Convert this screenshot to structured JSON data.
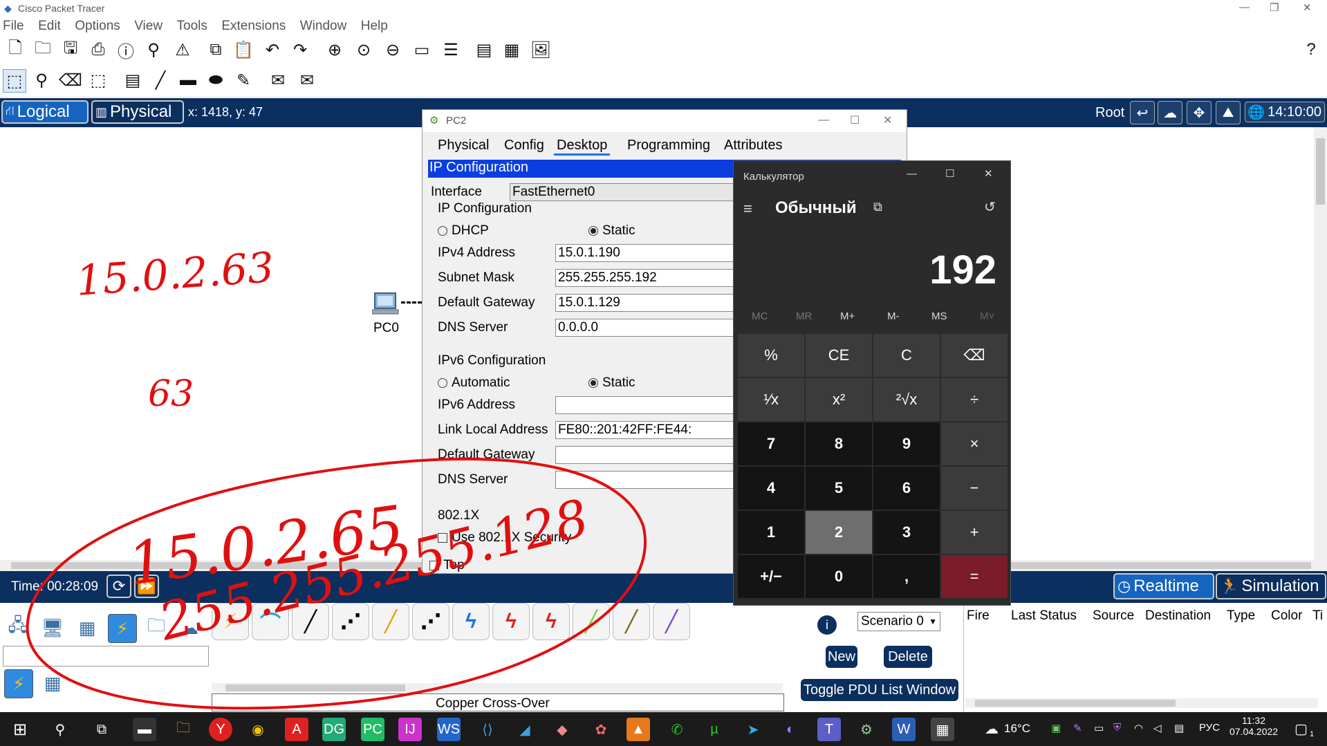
{
  "app": {
    "title": "Cisco Packet Tracer"
  },
  "menu": [
    "File",
    "Edit",
    "Options",
    "View",
    "Tools",
    "Extensions",
    "Window",
    "Help"
  ],
  "mode_bar": {
    "logical": "Logical",
    "physical": "Physical",
    "coords": "x: 1418, y: 47",
    "root": "Root",
    "clock": "14:10:00"
  },
  "workspace": {
    "device_label": "PC0"
  },
  "sim_bar": {
    "time": "Time: 00:28:09",
    "realtime": "Realtime",
    "simulation": "Simulation"
  },
  "bottom": {
    "cable_label": "Copper Cross-Over",
    "scenario": "Scenario 0",
    "new_btn": "New",
    "delete_btn": "Delete",
    "toggle_btn": "Toggle PDU List Window",
    "pdu_columns": [
      "Fire",
      "Last Status",
      "Source",
      "Destination",
      "Type",
      "Color",
      "Ti"
    ]
  },
  "pc2": {
    "title": "PC2",
    "tabs": [
      "Physical",
      "Config",
      "Desktop",
      "Programming",
      "Attributes"
    ],
    "active_tab": "Desktop",
    "panel_title": "IP Configuration",
    "interface_label": "Interface",
    "interface_value": "FastEthernet0",
    "ipv4_section": "IP Configuration",
    "dhcp": "DHCP",
    "static": "Static",
    "ipv4_label": "IPv4 Address",
    "ipv4_value": "15.0.1.190",
    "mask_label": "Subnet Mask",
    "mask_value": "255.255.255.192",
    "gw_label": "Default Gateway",
    "gw_value": "15.0.1.129",
    "dns_label": "DNS Server",
    "dns_value": "0.0.0.0",
    "ipv6_section": "IPv6 Configuration",
    "automatic": "Automatic",
    "static6": "Static",
    "ipv6_label": "IPv6 Address",
    "ipv6_value": "",
    "link_local_label": "Link Local Address",
    "link_local_value": "FE80::201:42FF:FE44:",
    "gw6_label": "Default Gateway",
    "gw6_value": "",
    "dns6_label": "DNS Server",
    "dns6_value": "",
    "dot1x": "802.1X",
    "use_dot1x": "Use 802.1X Security",
    "top_checkbox": "Top"
  },
  "calculator": {
    "title": "Калькулятор",
    "mode": "Обычный",
    "display": "192",
    "memory": [
      "MC",
      "MR",
      "M+",
      "M-",
      "MS",
      "M˅"
    ],
    "keys": [
      [
        "%",
        "CE",
        "C",
        "⌫"
      ],
      [
        "¹⁄x",
        "x²",
        "²√x",
        "÷"
      ],
      [
        "7",
        "8",
        "9",
        "×"
      ],
      [
        "4",
        "5",
        "6",
        "−"
      ],
      [
        "1",
        "2",
        "3",
        "+"
      ],
      [
        "+/−",
        "0",
        ",",
        "="
      ]
    ]
  },
  "handwriting": {
    "note1": "15.0.2.63",
    "note2": "63",
    "note3": "15.0.2.65",
    "note4": "255.255.255.128"
  },
  "taskbar": {
    "temperature": "16°C",
    "lang": "РУС",
    "time": "11:32",
    "date": "07.04.2022",
    "notifications": "1"
  },
  "colors": {
    "dark_blue": "#0b2f5e",
    "active_blue": "#1565c0",
    "ink_red": "#e01010",
    "calc_equals": "#7a1c2a"
  }
}
